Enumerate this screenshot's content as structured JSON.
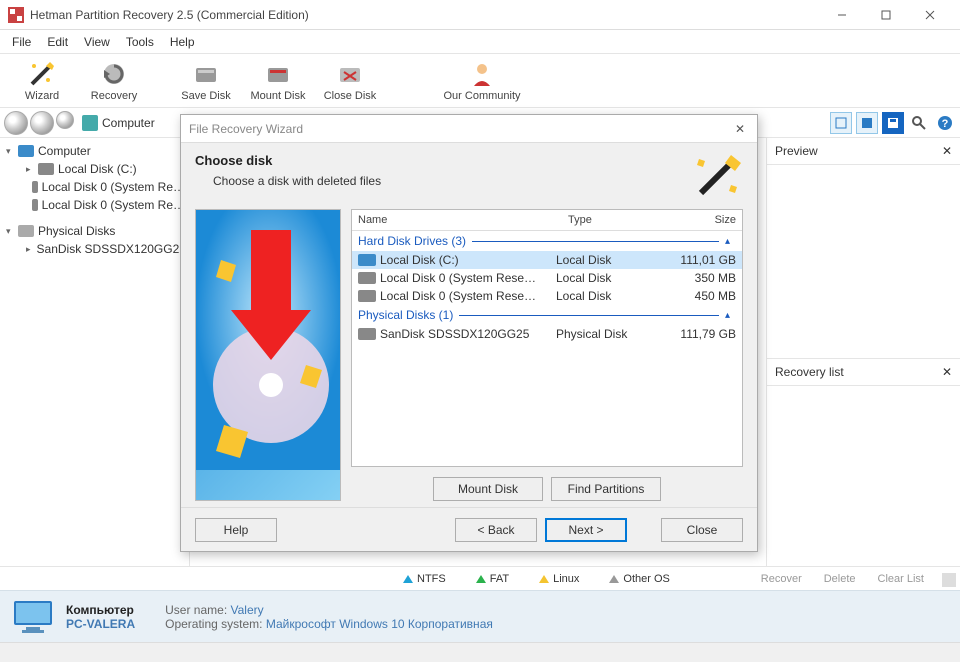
{
  "app": {
    "title": "Hetman Partition Recovery 2.5 (Commercial Edition)"
  },
  "menu": {
    "file": "File",
    "edit": "Edit",
    "view": "View",
    "tools": "Tools",
    "help": "Help"
  },
  "toolbar": {
    "wizard": "Wizard",
    "recovery": "Recovery",
    "save_disk": "Save Disk",
    "mount_disk": "Mount Disk",
    "close_disk": "Close Disk",
    "community": "Our Community"
  },
  "address": {
    "text": "Computer"
  },
  "tree": {
    "computer": "Computer",
    "items": [
      {
        "label": "Local Disk (C:)"
      },
      {
        "label": "Local Disk 0 (System Re…"
      },
      {
        "label": "Local Disk 0 (System Re…"
      }
    ],
    "physical": "Physical Disks",
    "physical_items": [
      {
        "label": "SanDisk SDSSDX120GG2…"
      }
    ]
  },
  "panes": {
    "preview": "Preview",
    "recovery_list": "Recovery list"
  },
  "legend": {
    "ntfs": "NTFS",
    "fat": "FAT",
    "linux": "Linux",
    "other": "Other OS"
  },
  "actions": {
    "recover": "Recover",
    "delete": "Delete",
    "clear": "Clear List"
  },
  "footer": {
    "computer": "Компьютер",
    "pcname": "PC-VALERA",
    "user_label": "User name:",
    "user": "Valery",
    "os_label": "Operating system:",
    "os": "Майкрософт Windows 10 Корпоративная"
  },
  "dialog": {
    "title": "File Recovery Wizard",
    "heading": "Choose disk",
    "sub": "Choose a disk with deleted files",
    "columns": {
      "name": "Name",
      "type": "Type",
      "size": "Size"
    },
    "group_hdd": "Hard Disk Drives (3)",
    "group_phys": "Physical Disks (1)",
    "rows_hdd": [
      {
        "name": "Local Disk (C:)",
        "type": "Local Disk",
        "size": "111,01 GB",
        "selected": true
      },
      {
        "name": "Local Disk 0 (System Rese…",
        "type": "Local Disk",
        "size": "350 MB"
      },
      {
        "name": "Local Disk 0 (System Rese…",
        "type": "Local Disk",
        "size": "450 MB"
      }
    ],
    "rows_phys": [
      {
        "name": "SanDisk SDSSDX120GG25",
        "type": "Physical Disk",
        "size": "111,79 GB"
      }
    ],
    "buttons": {
      "mount": "Mount Disk",
      "find": "Find Partitions",
      "help": "Help",
      "back": "< Back",
      "next": "Next >",
      "close": "Close"
    }
  }
}
